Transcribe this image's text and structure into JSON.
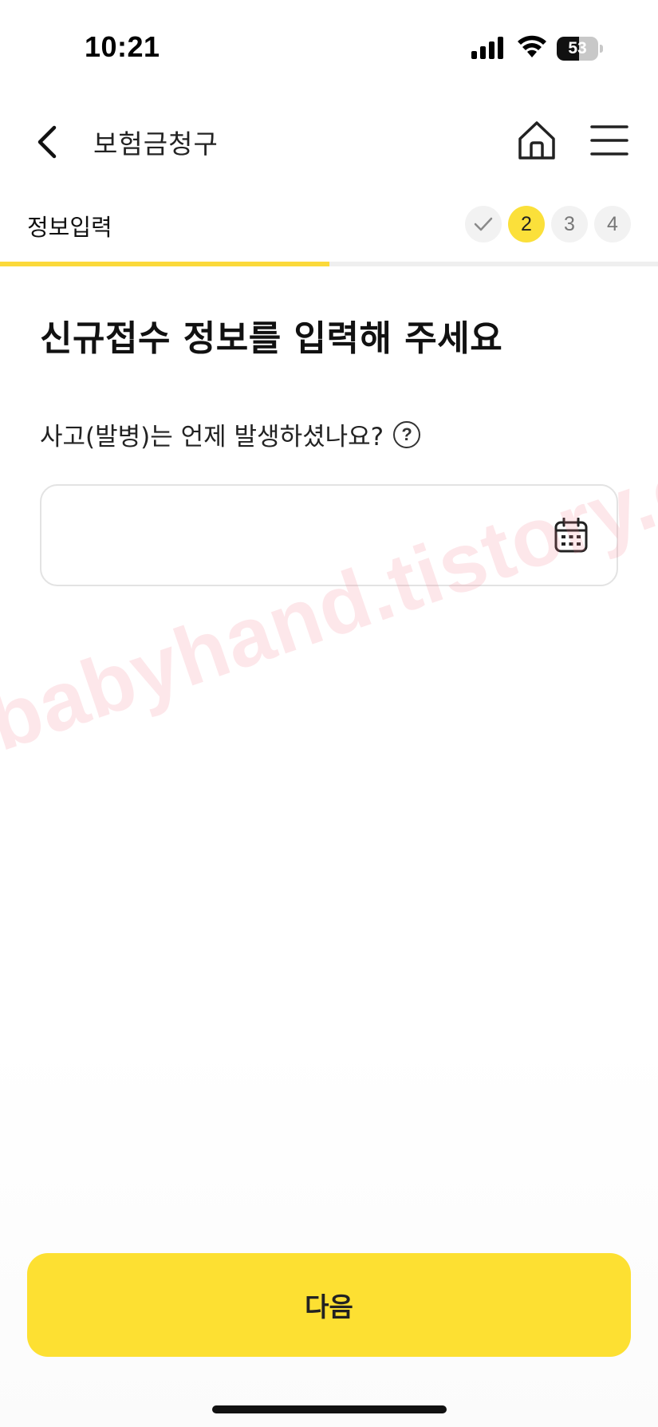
{
  "status_bar": {
    "time": "10:21",
    "battery_level": "53",
    "battery_fraction": 0.53
  },
  "header": {
    "title": "보험금청구",
    "back_icon": "chevron-left-icon",
    "home_icon": "home-icon",
    "menu_icon": "hamburger-menu-icon"
  },
  "steps": {
    "title": "정보입력",
    "items": [
      {
        "label": "",
        "state": "done",
        "icon": "check-icon"
      },
      {
        "label": "2",
        "state": "active"
      },
      {
        "label": "3",
        "state": "pending"
      },
      {
        "label": "4",
        "state": "pending"
      }
    ],
    "progress_fraction": 0.5
  },
  "main": {
    "heading": "신규접수 정보를 입력해 주세요",
    "field_label": "사고(발병)는 언제 발생하셨나요?",
    "help_symbol": "?",
    "date_value": "",
    "calendar_icon": "calendar-icon"
  },
  "watermark": "babyhand.tistory.com",
  "footer": {
    "next_label": "다음"
  },
  "colors": {
    "accent": "#fde032",
    "progress": "#fbd93a",
    "text": "#111111",
    "border": "#e3e3e3"
  }
}
